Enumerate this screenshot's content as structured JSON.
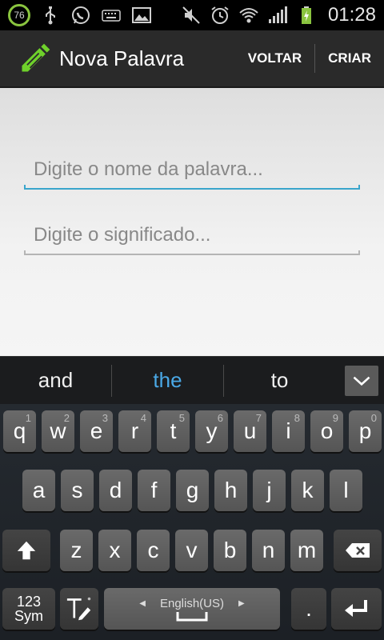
{
  "status_bar": {
    "battery_level": "76",
    "time": "01:28",
    "icons": [
      "battery-percent-icon",
      "usb-icon",
      "whatsapp-icon",
      "keyboard-icon",
      "image-icon",
      "mute-icon",
      "alarm-icon",
      "wifi-icon",
      "signal-icon",
      "charging-battery-icon"
    ]
  },
  "action_bar": {
    "title": "Nova Palavra",
    "back_label": "VOLTAR",
    "create_label": "CRIAR",
    "logo_icon": "pencil-icon",
    "logo_color": "#6fd12b"
  },
  "form": {
    "word_placeholder": "Digite o nome da palavra...",
    "meaning_placeholder": "Digite o significado...",
    "active_underline_color": "#3aa5cc"
  },
  "suggestions": {
    "items": [
      "and",
      "the",
      "to"
    ],
    "primary_color": "#4aa8e6"
  },
  "keyboard": {
    "row1": [
      {
        "k": "q",
        "h": "1"
      },
      {
        "k": "w",
        "h": "2"
      },
      {
        "k": "e",
        "h": "3"
      },
      {
        "k": "r",
        "h": "4"
      },
      {
        "k": "t",
        "h": "5"
      },
      {
        "k": "y",
        "h": "6"
      },
      {
        "k": "u",
        "h": "7"
      },
      {
        "k": "i",
        "h": "8"
      },
      {
        "k": "o",
        "h": "9"
      },
      {
        "k": "p",
        "h": "0"
      }
    ],
    "row2": [
      "a",
      "s",
      "d",
      "f",
      "g",
      "h",
      "j",
      "k",
      "l"
    ],
    "row3": [
      "z",
      "x",
      "c",
      "v",
      "b",
      "n",
      "m"
    ],
    "sym_label_top": "123",
    "sym_label_bottom": "Sym",
    "language_label": "English(US)",
    "period_label": "."
  }
}
